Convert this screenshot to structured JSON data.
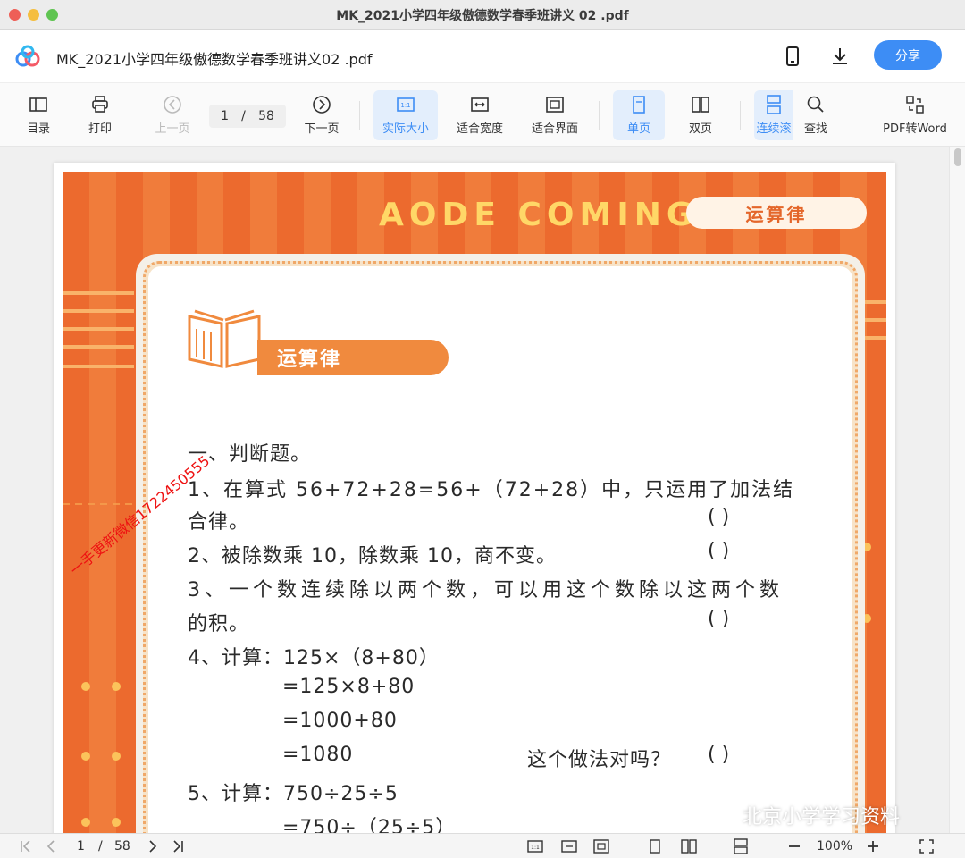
{
  "window": {
    "title": "MK_2021小学四年级傲德数学春季班讲义 02 .pdf"
  },
  "app": {
    "doc_title": "MK_2021小学四年级傲德数学春季班讲义02 .pdf",
    "share_label": "分享"
  },
  "toolbar": {
    "contents": "目录",
    "print": "打印",
    "prev": "上一页",
    "page_current": "1",
    "page_sep": "/",
    "page_total": "58",
    "next": "下一页",
    "actual_size": "实际大小",
    "fit_width": "适合宽度",
    "fit_page": "适合界面",
    "single_page": "单页",
    "double_page": "双页",
    "continuous": "连续滚",
    "find": "查找",
    "pdf_to_word": "PDF转Word"
  },
  "document": {
    "banner": "AODE COMING",
    "banner_pill": "运算律",
    "section_label": "运算律",
    "lines": [
      "一、判断题。",
      "1、在算式 56+72+28=56+（72+28）中，只运用了加法结",
      "合律。",
      "2、被除数乘 10，除数乘 10，商不变。",
      "3、一个数连续除以两个数，可以用这个数除以这两个数",
      "的积。",
      "4、计算：125×（8+80）",
      "=125×8+80",
      "=1000+80",
      "=1080",
      "5、计算：750÷25÷5",
      "=750÷（25÷5）"
    ],
    "question_4_suffix": "这个做法对吗？",
    "paren": "(          )",
    "watermark": "一手更新微信1722450555",
    "brand_watermark": "北京小学学习资料"
  },
  "statusbar": {
    "page_current": "1",
    "page_sep": "/",
    "page_total": "58",
    "zoom": "100%"
  },
  "colors": {
    "accent": "#3d8df5",
    "frame_orange": "#ec6a2e",
    "banner_yellow": "#ffd767"
  }
}
